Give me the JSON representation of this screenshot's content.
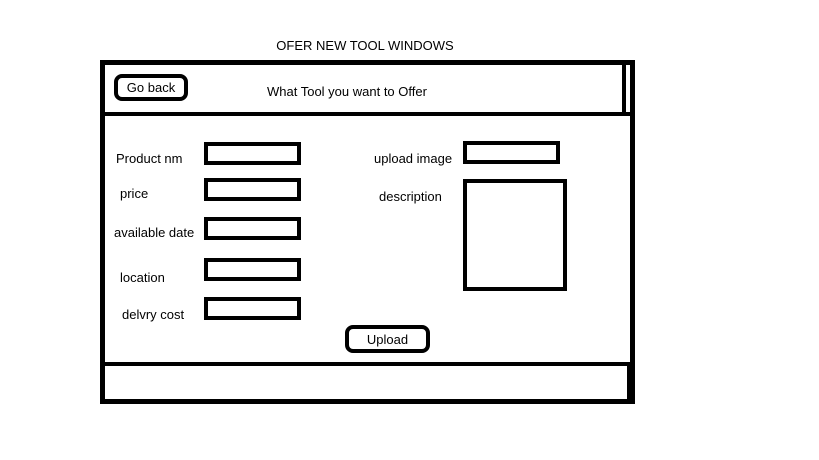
{
  "caption": "OFER NEW TOOL WINDOWS",
  "header": {
    "back_label": "Go back",
    "title": "What Tool you want to Offer"
  },
  "form": {
    "product_name_label": "Product nm",
    "price_label": "price",
    "available_date_label": "available date",
    "location_label": "location",
    "delivery_cost_label": "delvry cost",
    "upload_image_label": "upload image",
    "description_label": "description",
    "upload_label": "Upload"
  }
}
